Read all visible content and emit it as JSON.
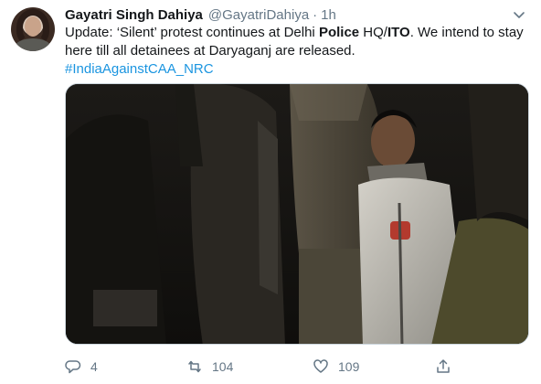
{
  "author": {
    "display_name": "Gayatri Singh Dahiya",
    "handle": "@GayatriDahiya",
    "separator": "·",
    "time": "1h"
  },
  "tweet": {
    "text_part1": "Update: ‘Silent’ protest continues at Delhi ",
    "bold1": "Police",
    "text_part2": " HQ/",
    "bold2": "ITO",
    "text_part3": ". We intend to stay here till all detainees at Daryaganj are released.",
    "hashtag": "#IndiaAgainstCAA_NRC"
  },
  "actions": {
    "reply_count": "4",
    "retweet_count": "104",
    "like_count": "109"
  },
  "colors": {
    "link": "#1b95e0",
    "secondary": "#657786",
    "text": "#14171a"
  },
  "icons": {
    "menu": "chevron-down-icon",
    "reply": "reply-icon",
    "retweet": "retweet-icon",
    "like": "heart-icon",
    "share": "share-icon"
  }
}
